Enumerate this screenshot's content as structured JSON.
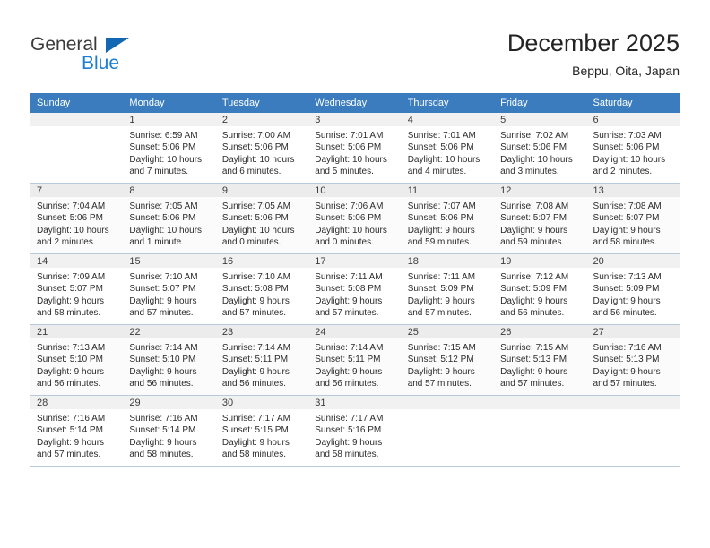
{
  "brand": {
    "name_part1": "General",
    "name_part2": "Blue",
    "triangle_color": "#1268b3",
    "blue_color": "#1a7fd4"
  },
  "header": {
    "title": "December 2025",
    "subtitle": "Beppu, Oita, Japan",
    "header_bg": "#3a7cbe"
  },
  "weekdays": [
    "Sunday",
    "Monday",
    "Tuesday",
    "Wednesday",
    "Thursday",
    "Friday",
    "Saturday"
  ],
  "weeks": [
    [
      {
        "day": "",
        "sunrise": "",
        "sunset": "",
        "daylight1": "",
        "daylight2": "",
        "empty": true
      },
      {
        "day": "1",
        "sunrise": "Sunrise: 6:59 AM",
        "sunset": "Sunset: 5:06 PM",
        "daylight1": "Daylight: 10 hours",
        "daylight2": "and 7 minutes."
      },
      {
        "day": "2",
        "sunrise": "Sunrise: 7:00 AM",
        "sunset": "Sunset: 5:06 PM",
        "daylight1": "Daylight: 10 hours",
        "daylight2": "and 6 minutes."
      },
      {
        "day": "3",
        "sunrise": "Sunrise: 7:01 AM",
        "sunset": "Sunset: 5:06 PM",
        "daylight1": "Daylight: 10 hours",
        "daylight2": "and 5 minutes."
      },
      {
        "day": "4",
        "sunrise": "Sunrise: 7:01 AM",
        "sunset": "Sunset: 5:06 PM",
        "daylight1": "Daylight: 10 hours",
        "daylight2": "and 4 minutes."
      },
      {
        "day": "5",
        "sunrise": "Sunrise: 7:02 AM",
        "sunset": "Sunset: 5:06 PM",
        "daylight1": "Daylight: 10 hours",
        "daylight2": "and 3 minutes."
      },
      {
        "day": "6",
        "sunrise": "Sunrise: 7:03 AM",
        "sunset": "Sunset: 5:06 PM",
        "daylight1": "Daylight: 10 hours",
        "daylight2": "and 2 minutes."
      }
    ],
    [
      {
        "day": "7",
        "sunrise": "Sunrise: 7:04 AM",
        "sunset": "Sunset: 5:06 PM",
        "daylight1": "Daylight: 10 hours",
        "daylight2": "and 2 minutes."
      },
      {
        "day": "8",
        "sunrise": "Sunrise: 7:05 AM",
        "sunset": "Sunset: 5:06 PM",
        "daylight1": "Daylight: 10 hours",
        "daylight2": "and 1 minute."
      },
      {
        "day": "9",
        "sunrise": "Sunrise: 7:05 AM",
        "sunset": "Sunset: 5:06 PM",
        "daylight1": "Daylight: 10 hours",
        "daylight2": "and 0 minutes."
      },
      {
        "day": "10",
        "sunrise": "Sunrise: 7:06 AM",
        "sunset": "Sunset: 5:06 PM",
        "daylight1": "Daylight: 10 hours",
        "daylight2": "and 0 minutes."
      },
      {
        "day": "11",
        "sunrise": "Sunrise: 7:07 AM",
        "sunset": "Sunset: 5:06 PM",
        "daylight1": "Daylight: 9 hours",
        "daylight2": "and 59 minutes."
      },
      {
        "day": "12",
        "sunrise": "Sunrise: 7:08 AM",
        "sunset": "Sunset: 5:07 PM",
        "daylight1": "Daylight: 9 hours",
        "daylight2": "and 59 minutes."
      },
      {
        "day": "13",
        "sunrise": "Sunrise: 7:08 AM",
        "sunset": "Sunset: 5:07 PM",
        "daylight1": "Daylight: 9 hours",
        "daylight2": "and 58 minutes."
      }
    ],
    [
      {
        "day": "14",
        "sunrise": "Sunrise: 7:09 AM",
        "sunset": "Sunset: 5:07 PM",
        "daylight1": "Daylight: 9 hours",
        "daylight2": "and 58 minutes."
      },
      {
        "day": "15",
        "sunrise": "Sunrise: 7:10 AM",
        "sunset": "Sunset: 5:07 PM",
        "daylight1": "Daylight: 9 hours",
        "daylight2": "and 57 minutes."
      },
      {
        "day": "16",
        "sunrise": "Sunrise: 7:10 AM",
        "sunset": "Sunset: 5:08 PM",
        "daylight1": "Daylight: 9 hours",
        "daylight2": "and 57 minutes."
      },
      {
        "day": "17",
        "sunrise": "Sunrise: 7:11 AM",
        "sunset": "Sunset: 5:08 PM",
        "daylight1": "Daylight: 9 hours",
        "daylight2": "and 57 minutes."
      },
      {
        "day": "18",
        "sunrise": "Sunrise: 7:11 AM",
        "sunset": "Sunset: 5:09 PM",
        "daylight1": "Daylight: 9 hours",
        "daylight2": "and 57 minutes."
      },
      {
        "day": "19",
        "sunrise": "Sunrise: 7:12 AM",
        "sunset": "Sunset: 5:09 PM",
        "daylight1": "Daylight: 9 hours",
        "daylight2": "and 56 minutes."
      },
      {
        "day": "20",
        "sunrise": "Sunrise: 7:13 AM",
        "sunset": "Sunset: 5:09 PM",
        "daylight1": "Daylight: 9 hours",
        "daylight2": "and 56 minutes."
      }
    ],
    [
      {
        "day": "21",
        "sunrise": "Sunrise: 7:13 AM",
        "sunset": "Sunset: 5:10 PM",
        "daylight1": "Daylight: 9 hours",
        "daylight2": "and 56 minutes."
      },
      {
        "day": "22",
        "sunrise": "Sunrise: 7:14 AM",
        "sunset": "Sunset: 5:10 PM",
        "daylight1": "Daylight: 9 hours",
        "daylight2": "and 56 minutes."
      },
      {
        "day": "23",
        "sunrise": "Sunrise: 7:14 AM",
        "sunset": "Sunset: 5:11 PM",
        "daylight1": "Daylight: 9 hours",
        "daylight2": "and 56 minutes."
      },
      {
        "day": "24",
        "sunrise": "Sunrise: 7:14 AM",
        "sunset": "Sunset: 5:11 PM",
        "daylight1": "Daylight: 9 hours",
        "daylight2": "and 56 minutes."
      },
      {
        "day": "25",
        "sunrise": "Sunrise: 7:15 AM",
        "sunset": "Sunset: 5:12 PM",
        "daylight1": "Daylight: 9 hours",
        "daylight2": "and 57 minutes."
      },
      {
        "day": "26",
        "sunrise": "Sunrise: 7:15 AM",
        "sunset": "Sunset: 5:13 PM",
        "daylight1": "Daylight: 9 hours",
        "daylight2": "and 57 minutes."
      },
      {
        "day": "27",
        "sunrise": "Sunrise: 7:16 AM",
        "sunset": "Sunset: 5:13 PM",
        "daylight1": "Daylight: 9 hours",
        "daylight2": "and 57 minutes."
      }
    ],
    [
      {
        "day": "28",
        "sunrise": "Sunrise: 7:16 AM",
        "sunset": "Sunset: 5:14 PM",
        "daylight1": "Daylight: 9 hours",
        "daylight2": "and 57 minutes."
      },
      {
        "day": "29",
        "sunrise": "Sunrise: 7:16 AM",
        "sunset": "Sunset: 5:14 PM",
        "daylight1": "Daylight: 9 hours",
        "daylight2": "and 58 minutes."
      },
      {
        "day": "30",
        "sunrise": "Sunrise: 7:17 AM",
        "sunset": "Sunset: 5:15 PM",
        "daylight1": "Daylight: 9 hours",
        "daylight2": "and 58 minutes."
      },
      {
        "day": "31",
        "sunrise": "Sunrise: 7:17 AM",
        "sunset": "Sunset: 5:16 PM",
        "daylight1": "Daylight: 9 hours",
        "daylight2": "and 58 minutes."
      },
      {
        "day": "",
        "sunrise": "",
        "sunset": "",
        "daylight1": "",
        "daylight2": "",
        "empty": true
      },
      {
        "day": "",
        "sunrise": "",
        "sunset": "",
        "daylight1": "",
        "daylight2": "",
        "empty": true
      },
      {
        "day": "",
        "sunrise": "",
        "sunset": "",
        "daylight1": "",
        "daylight2": "",
        "empty": true
      }
    ]
  ]
}
